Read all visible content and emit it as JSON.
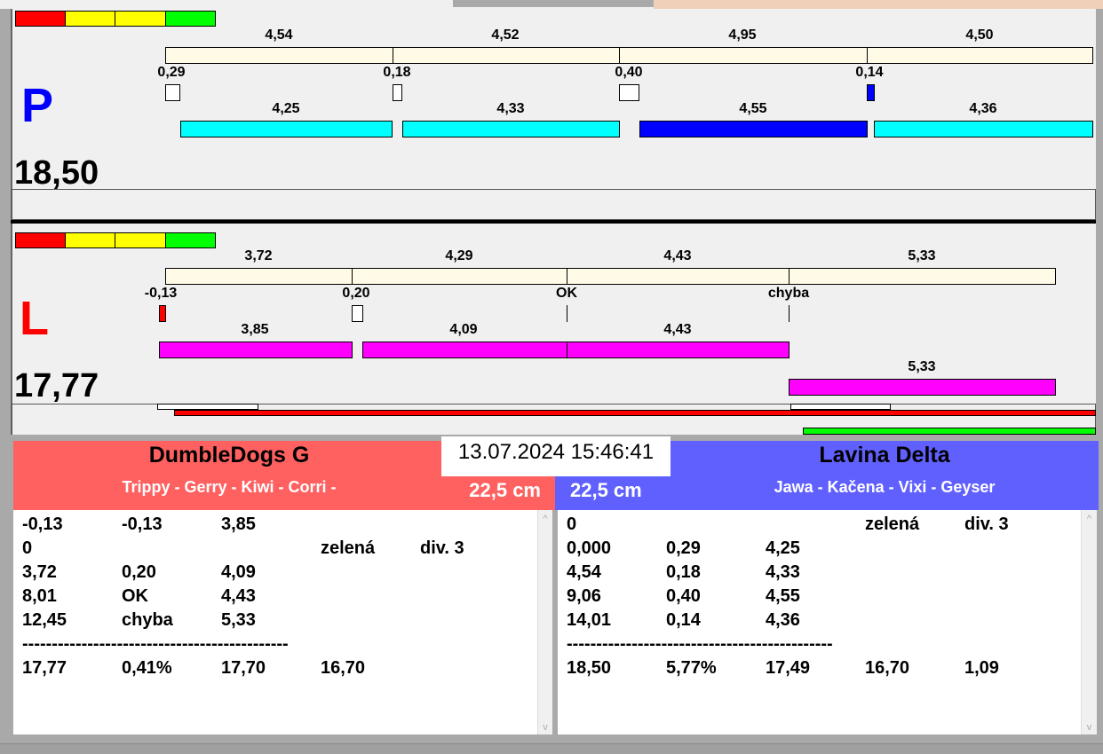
{
  "colors": {
    "red": "#ff0000",
    "yellow": "#ffff00",
    "green": "#00ff00",
    "cream": "#fffbe6",
    "cyan": "#00ffff",
    "blue": "#0000ff",
    "magenta": "#ff00ff",
    "team_left": "#ff6060",
    "team_right": "#6060ff"
  },
  "p_lane": {
    "letter": "P",
    "total": "18,50",
    "segments": [
      "4,54",
      "4,52",
      "4,95",
      "4,50"
    ],
    "reactions": [
      "0,29",
      "0,18",
      "0,40",
      "0,14"
    ],
    "runs": [
      "4,25",
      "4,33",
      "4,55",
      "4,36"
    ]
  },
  "l_lane": {
    "letter": "L",
    "total": "17,77",
    "segments": [
      "3,72",
      "4,29",
      "4,43",
      "5,33"
    ],
    "reactions": [
      "-0,13",
      "0,20",
      "OK",
      "chyba"
    ],
    "runs": [
      "3,85",
      "4,09",
      "4,43",
      "5,33"
    ]
  },
  "datetime": "13.07.2024 15:46:41",
  "left_team": {
    "name": "DumbleDogs G",
    "dogs": "Trippy - Gerry - Kiwi - Corri -",
    "height": "22,5 cm",
    "rows": [
      [
        "-0,13",
        "-0,13",
        "3,85",
        "",
        ""
      ],
      [
        "0",
        "",
        "",
        "zelená",
        "div. 3"
      ],
      [
        "3,72",
        "0,20",
        "4,09",
        "",
        ""
      ],
      [
        "8,01",
        "OK",
        "4,43",
        "",
        ""
      ],
      [
        "12,45",
        "chyba",
        "5,33",
        "",
        ""
      ],
      [
        "---------------------------------------------"
      ],
      [
        "17,77",
        "0,41%",
        "17,70",
        "16,70",
        ""
      ]
    ]
  },
  "right_team": {
    "name": "Lavina Delta",
    "dogs": "Jawa - Kačena - Vixi - Geyser",
    "height": "22,5 cm",
    "rows": [
      [
        "0",
        "",
        "",
        "zelená",
        "div. 3"
      ],
      [
        "0,000",
        "0,29",
        "4,25",
        "",
        ""
      ],
      [
        "4,54",
        "0,18",
        "4,33",
        "",
        ""
      ],
      [
        "9,06",
        "0,40",
        "4,55",
        "",
        ""
      ],
      [
        "14,01",
        "0,14",
        "4,36",
        "",
        ""
      ],
      [
        "---------------------------------------------"
      ],
      [
        "18,50",
        "5,77%",
        "17,49",
        "16,70",
        "1,09"
      ]
    ]
  }
}
